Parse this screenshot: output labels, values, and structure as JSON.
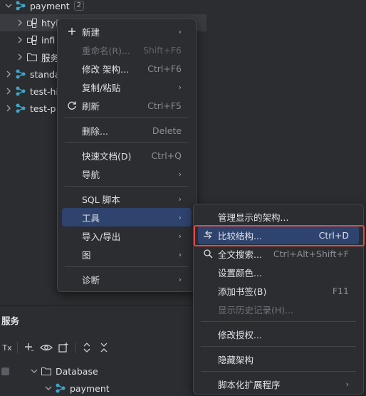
{
  "tree": {
    "root": {
      "label": "payment",
      "badge": "2"
    },
    "children": [
      {
        "label": "htyi"
      },
      {
        "label": "infi"
      },
      {
        "label": "服务"
      }
    ],
    "siblings": [
      {
        "label": "standa"
      },
      {
        "label": "test-hi"
      },
      {
        "label": "test-p"
      }
    ]
  },
  "services": {
    "title": "服务",
    "tx_label": "Tx",
    "items": [
      {
        "label": "Database"
      },
      {
        "label": "payment"
      }
    ]
  },
  "context_menu": {
    "items": [
      {
        "label": "新建",
        "shortcut": "",
        "submenu": true,
        "icon": "plus-icon",
        "disabled": false
      },
      {
        "label": "重命名(R)...",
        "shortcut": "Shift+F6",
        "submenu": false,
        "disabled": true
      },
      {
        "label": "修改 架构...",
        "shortcut": "Ctrl+F6",
        "submenu": false,
        "disabled": false
      },
      {
        "label": "复制/粘贴",
        "shortcut": "",
        "submenu": true,
        "disabled": false
      },
      {
        "label": "刷新",
        "shortcut": "Ctrl+F5",
        "submenu": false,
        "icon": "refresh-icon",
        "disabled": false
      },
      {
        "label": "删除...",
        "shortcut": "Delete",
        "submenu": false,
        "disabled": false
      },
      {
        "label": "快速文档(D)",
        "shortcut": "Ctrl+Q",
        "submenu": false,
        "disabled": false
      },
      {
        "label": "导航",
        "shortcut": "",
        "submenu": true,
        "disabled": false
      },
      {
        "label": "SQL 脚本",
        "shortcut": "",
        "submenu": true,
        "disabled": false
      },
      {
        "label": "工具",
        "shortcut": "",
        "submenu": true,
        "disabled": false
      },
      {
        "label": "导入/导出",
        "shortcut": "",
        "submenu": true,
        "disabled": false
      },
      {
        "label": "图",
        "shortcut": "",
        "submenu": true,
        "disabled": false
      },
      {
        "label": "诊断",
        "shortcut": "",
        "submenu": true,
        "disabled": false
      }
    ]
  },
  "tools_submenu": {
    "items": [
      {
        "label": "管理显示的架构...",
        "shortcut": "",
        "submenu": false,
        "disabled": false
      },
      {
        "label": "比较结构...",
        "shortcut": "Ctrl+D",
        "submenu": false,
        "icon": "compare-icon",
        "disabled": false
      },
      {
        "label": "全文搜索...",
        "shortcut": "Ctrl+Alt+Shift+F",
        "submenu": false,
        "icon": "search-icon",
        "disabled": false
      },
      {
        "label": "设置颜色...",
        "shortcut": "",
        "submenu": false,
        "disabled": false
      },
      {
        "label": "添加书签(B)",
        "shortcut": "F11",
        "submenu": false,
        "disabled": false
      },
      {
        "label": "显示历史记录(H)...",
        "shortcut": "",
        "submenu": false,
        "disabled": true
      },
      {
        "label": "修改授权...",
        "shortcut": "",
        "submenu": false,
        "disabled": false
      },
      {
        "label": "隐藏架构",
        "shortcut": "",
        "submenu": false,
        "disabled": false
      },
      {
        "label": "脚本化扩展程序",
        "shortcut": "",
        "submenu": true,
        "disabled": false
      }
    ]
  },
  "colors": {
    "background": "#2b2d30",
    "selection": "#2e436e",
    "highlight_border": "#e04a4a",
    "schema_icon": "#3fa6c9"
  }
}
